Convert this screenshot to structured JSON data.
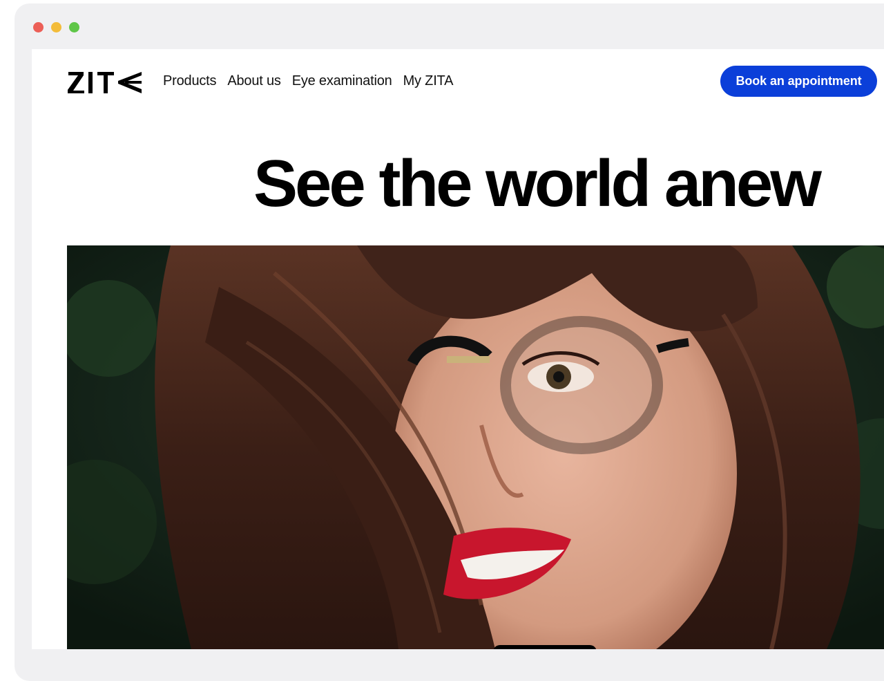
{
  "brand": {
    "logo_text": "ZITA"
  },
  "nav": {
    "links": [
      "Products",
      "About us",
      "Eye examination",
      "My ZITA"
    ]
  },
  "cta": {
    "label": "Book an appointment",
    "color": "#0b3fd9"
  },
  "hero": {
    "title": "See the world anew",
    "image_alt": "Smiling woman with dark wavy hair wearing black round glasses"
  },
  "window": {
    "controls": [
      "close",
      "minimize",
      "maximize"
    ]
  }
}
